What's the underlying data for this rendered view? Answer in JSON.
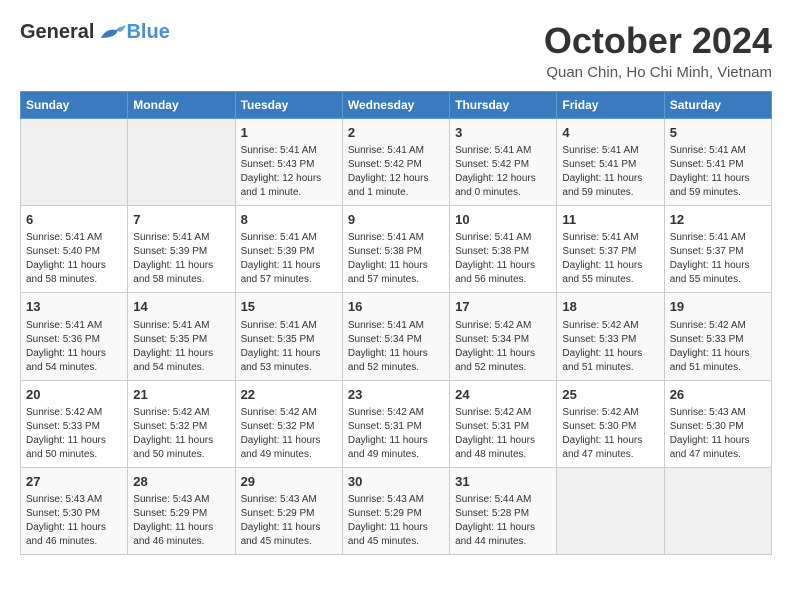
{
  "logo": {
    "general": "General",
    "blue": "Blue"
  },
  "header": {
    "month": "October 2024",
    "location": "Quan Chin, Ho Chi Minh, Vietnam"
  },
  "weekdays": [
    "Sunday",
    "Monday",
    "Tuesday",
    "Wednesday",
    "Thursday",
    "Friday",
    "Saturday"
  ],
  "weeks": [
    [
      {
        "day": "",
        "info": ""
      },
      {
        "day": "",
        "info": ""
      },
      {
        "day": "1",
        "info": "Sunrise: 5:41 AM\nSunset: 5:43 PM\nDaylight: 12 hours and 1 minute."
      },
      {
        "day": "2",
        "info": "Sunrise: 5:41 AM\nSunset: 5:42 PM\nDaylight: 12 hours and 1 minute."
      },
      {
        "day": "3",
        "info": "Sunrise: 5:41 AM\nSunset: 5:42 PM\nDaylight: 12 hours and 0 minutes."
      },
      {
        "day": "4",
        "info": "Sunrise: 5:41 AM\nSunset: 5:41 PM\nDaylight: 11 hours and 59 minutes."
      },
      {
        "day": "5",
        "info": "Sunrise: 5:41 AM\nSunset: 5:41 PM\nDaylight: 11 hours and 59 minutes."
      }
    ],
    [
      {
        "day": "6",
        "info": "Sunrise: 5:41 AM\nSunset: 5:40 PM\nDaylight: 11 hours and 58 minutes."
      },
      {
        "day": "7",
        "info": "Sunrise: 5:41 AM\nSunset: 5:39 PM\nDaylight: 11 hours and 58 minutes."
      },
      {
        "day": "8",
        "info": "Sunrise: 5:41 AM\nSunset: 5:39 PM\nDaylight: 11 hours and 57 minutes."
      },
      {
        "day": "9",
        "info": "Sunrise: 5:41 AM\nSunset: 5:38 PM\nDaylight: 11 hours and 57 minutes."
      },
      {
        "day": "10",
        "info": "Sunrise: 5:41 AM\nSunset: 5:38 PM\nDaylight: 11 hours and 56 minutes."
      },
      {
        "day": "11",
        "info": "Sunrise: 5:41 AM\nSunset: 5:37 PM\nDaylight: 11 hours and 55 minutes."
      },
      {
        "day": "12",
        "info": "Sunrise: 5:41 AM\nSunset: 5:37 PM\nDaylight: 11 hours and 55 minutes."
      }
    ],
    [
      {
        "day": "13",
        "info": "Sunrise: 5:41 AM\nSunset: 5:36 PM\nDaylight: 11 hours and 54 minutes."
      },
      {
        "day": "14",
        "info": "Sunrise: 5:41 AM\nSunset: 5:35 PM\nDaylight: 11 hours and 54 minutes."
      },
      {
        "day": "15",
        "info": "Sunrise: 5:41 AM\nSunset: 5:35 PM\nDaylight: 11 hours and 53 minutes."
      },
      {
        "day": "16",
        "info": "Sunrise: 5:41 AM\nSunset: 5:34 PM\nDaylight: 11 hours and 52 minutes."
      },
      {
        "day": "17",
        "info": "Sunrise: 5:42 AM\nSunset: 5:34 PM\nDaylight: 11 hours and 52 minutes."
      },
      {
        "day": "18",
        "info": "Sunrise: 5:42 AM\nSunset: 5:33 PM\nDaylight: 11 hours and 51 minutes."
      },
      {
        "day": "19",
        "info": "Sunrise: 5:42 AM\nSunset: 5:33 PM\nDaylight: 11 hours and 51 minutes."
      }
    ],
    [
      {
        "day": "20",
        "info": "Sunrise: 5:42 AM\nSunset: 5:33 PM\nDaylight: 11 hours and 50 minutes."
      },
      {
        "day": "21",
        "info": "Sunrise: 5:42 AM\nSunset: 5:32 PM\nDaylight: 11 hours and 50 minutes."
      },
      {
        "day": "22",
        "info": "Sunrise: 5:42 AM\nSunset: 5:32 PM\nDaylight: 11 hours and 49 minutes."
      },
      {
        "day": "23",
        "info": "Sunrise: 5:42 AM\nSunset: 5:31 PM\nDaylight: 11 hours and 49 minutes."
      },
      {
        "day": "24",
        "info": "Sunrise: 5:42 AM\nSunset: 5:31 PM\nDaylight: 11 hours and 48 minutes."
      },
      {
        "day": "25",
        "info": "Sunrise: 5:42 AM\nSunset: 5:30 PM\nDaylight: 11 hours and 47 minutes."
      },
      {
        "day": "26",
        "info": "Sunrise: 5:43 AM\nSunset: 5:30 PM\nDaylight: 11 hours and 47 minutes."
      }
    ],
    [
      {
        "day": "27",
        "info": "Sunrise: 5:43 AM\nSunset: 5:30 PM\nDaylight: 11 hours and 46 minutes."
      },
      {
        "day": "28",
        "info": "Sunrise: 5:43 AM\nSunset: 5:29 PM\nDaylight: 11 hours and 46 minutes."
      },
      {
        "day": "29",
        "info": "Sunrise: 5:43 AM\nSunset: 5:29 PM\nDaylight: 11 hours and 45 minutes."
      },
      {
        "day": "30",
        "info": "Sunrise: 5:43 AM\nSunset: 5:29 PM\nDaylight: 11 hours and 45 minutes."
      },
      {
        "day": "31",
        "info": "Sunrise: 5:44 AM\nSunset: 5:28 PM\nDaylight: 11 hours and 44 minutes."
      },
      {
        "day": "",
        "info": ""
      },
      {
        "day": "",
        "info": ""
      }
    ]
  ]
}
